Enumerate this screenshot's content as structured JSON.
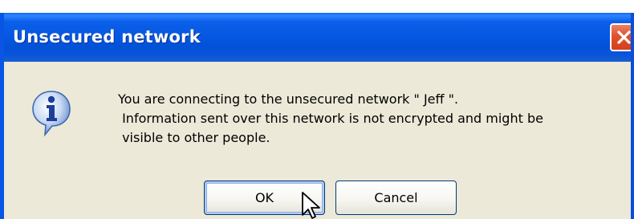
{
  "dialog": {
    "title": "Unsecured network",
    "close_icon": "close-icon",
    "info_icon": "info-icon",
    "message": "You are connecting to the unsecured network \" Jeff \".\n Information sent over this network is not encrypted and might be\n visible to other people.",
    "buttons": {
      "ok_label": "OK",
      "cancel_label": "Cancel"
    }
  },
  "colors": {
    "titlebar": "#0559e2",
    "close": "#e1512f",
    "body": "#ece9d8"
  }
}
